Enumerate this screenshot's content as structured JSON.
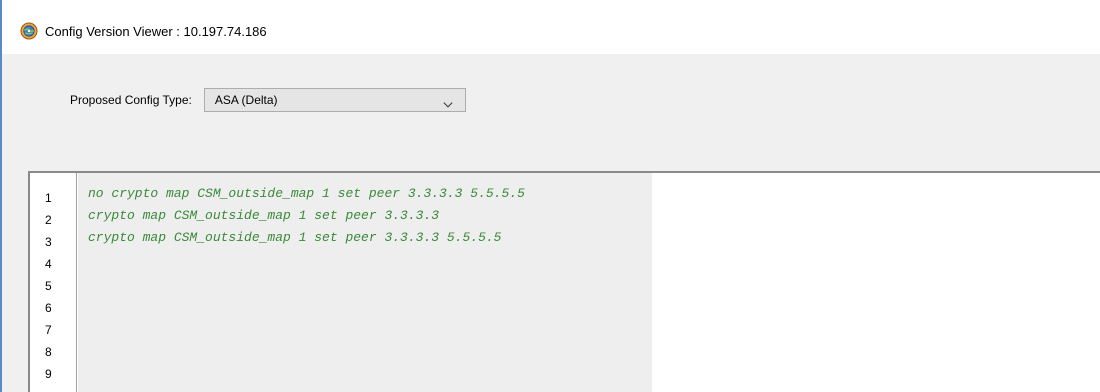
{
  "window": {
    "title": "Config Version Viewer : 10.197.74.186",
    "icon": "globe-gear-icon"
  },
  "form": {
    "label": "Proposed Config Type:",
    "select": {
      "value": "ASA (Delta)",
      "arrow_icon": "chevron-down-icon"
    }
  },
  "editor": {
    "line_numbers": [
      "1",
      "2",
      "3",
      "4",
      "5",
      "6",
      "7",
      "8",
      "9"
    ],
    "lines": [
      "no crypto map CSM_outside_map 1 set peer 3.3.3.3 5.5.5.5",
      "crypto map CSM_outside_map 1 set peer 3.3.3.3",
      "crypto map CSM_outside_map 1 set peer 3.3.3.3 5.5.5.5"
    ],
    "code_color": "#3a8a3a"
  }
}
